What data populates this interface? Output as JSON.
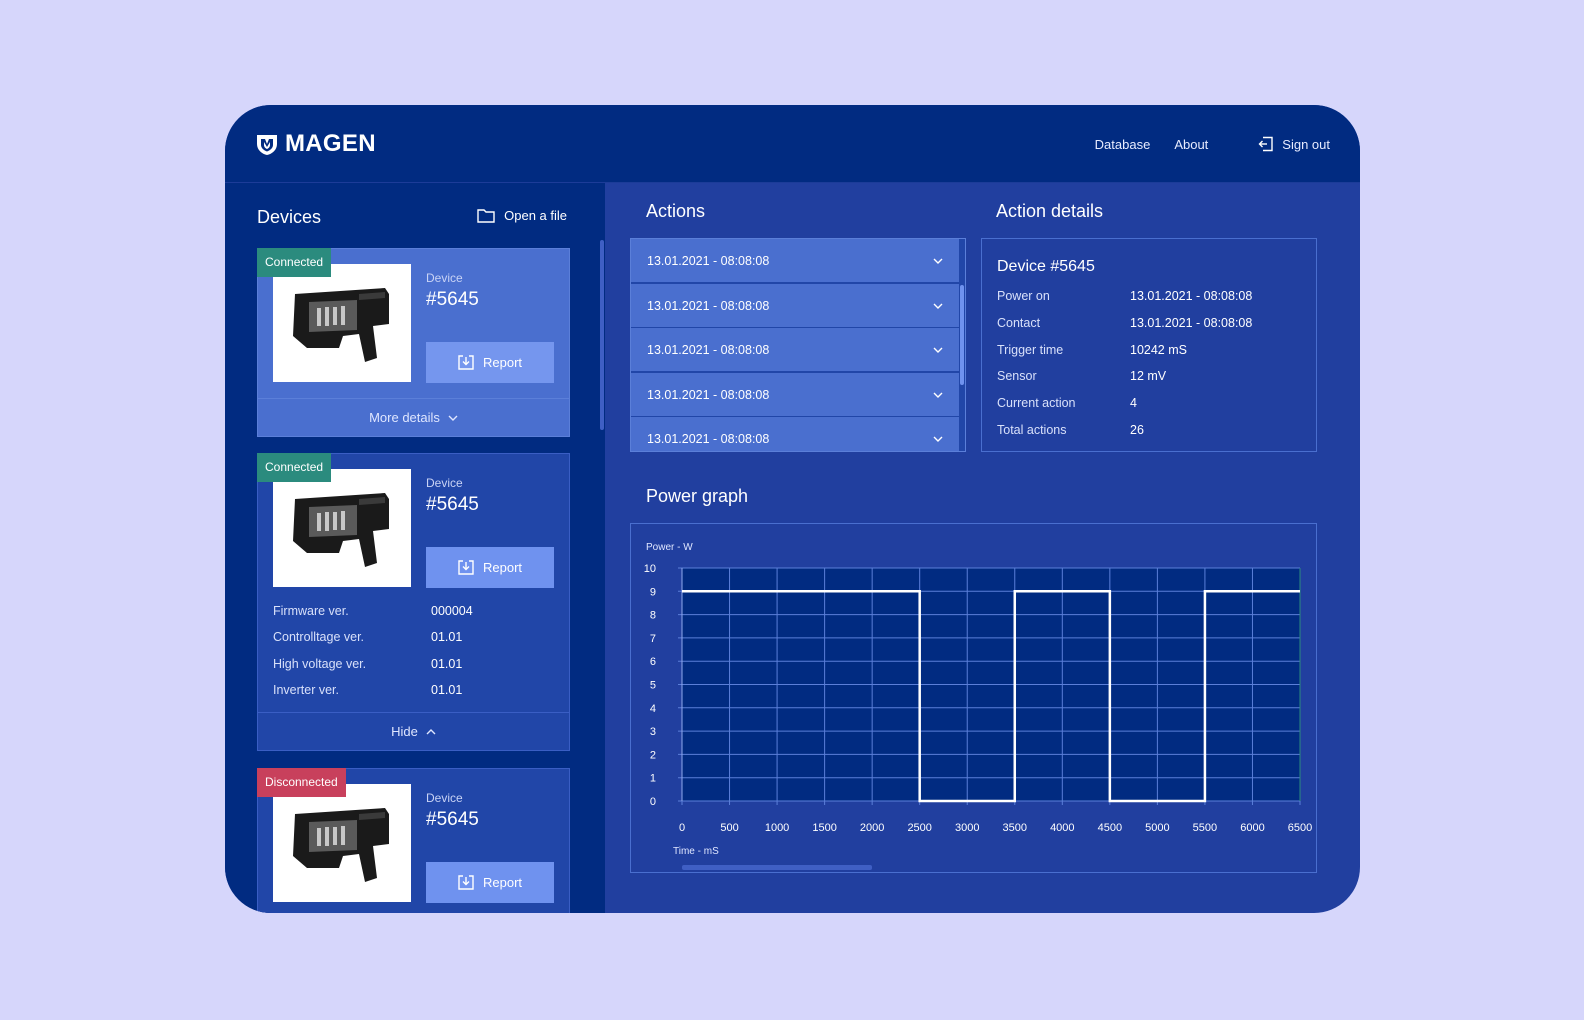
{
  "header": {
    "logo_text": "MAGEN",
    "nav": [
      "Database",
      "About"
    ],
    "sign_out": "Sign out"
  },
  "sidebar": {
    "title": "Devices",
    "open_file": "Open a file",
    "cards": [
      {
        "status": "Connected",
        "device_label": "Device",
        "device_number": "#5645",
        "report": "Report",
        "more": "More details"
      },
      {
        "status": "Connected",
        "device_label": "Device",
        "device_number": "#5645",
        "report": "Report",
        "specs": [
          {
            "label": "Firmware ver.",
            "value": "000004"
          },
          {
            "label": "Controlltage ver.",
            "value": "01.01"
          },
          {
            "label": "High voltage ver.",
            "value": "01.01"
          },
          {
            "label": "Inverter ver.",
            "value": "01.01"
          }
        ],
        "hide": "Hide"
      },
      {
        "status": "Disconnected",
        "device_label": "Device",
        "device_number": "#5645",
        "report": "Report"
      }
    ]
  },
  "actions": {
    "title": "Actions",
    "items": [
      "13.01.2021 - 08:08:08",
      "13.01.2021 - 08:08:08",
      "13.01.2021 - 08:08:08",
      "13.01.2021 - 08:08:08",
      "13.01.2021 - 08:08:08"
    ]
  },
  "details": {
    "title": "Action details",
    "device": "Device #5645",
    "rows": [
      {
        "label": "Power on",
        "value": "13.01.2021 - 08:08:08"
      },
      {
        "label": "Contact",
        "value": "13.01.2021 - 08:08:08"
      },
      {
        "label": "Trigger time",
        "value": "10242 mS"
      },
      {
        "label": "Sensor",
        "value": "12 mV"
      },
      {
        "label": "Current action",
        "value": "4"
      },
      {
        "label": "Total actions",
        "value": "26"
      }
    ]
  },
  "graph": {
    "title": "Power graph"
  },
  "chart_data": {
    "type": "line",
    "ylabel": "Power - W",
    "xlabel": "Time - mS",
    "xlim": [
      0,
      6500
    ],
    "ylim": [
      0,
      10
    ],
    "x_ticks": [
      0,
      500,
      1000,
      1500,
      2000,
      2500,
      3000,
      3500,
      4000,
      4500,
      5000,
      5500,
      6000,
      6500
    ],
    "y_ticks": [
      0,
      1,
      2,
      3,
      4,
      5,
      6,
      7,
      8,
      9,
      10
    ],
    "grid": true,
    "series": [
      {
        "x": [
          0,
          2500,
          2500,
          3500,
          3500,
          4500,
          4500,
          5500,
          5500,
          6500
        ],
        "y": [
          9,
          9,
          0,
          0,
          9,
          9,
          0,
          0,
          9,
          9
        ]
      }
    ]
  },
  "colors": {
    "connected": "#2b8b7e",
    "disconnected": "#c8405c",
    "plot_bg": "#012b81",
    "grid": "#5b7fd9",
    "line": "#ffffff"
  }
}
